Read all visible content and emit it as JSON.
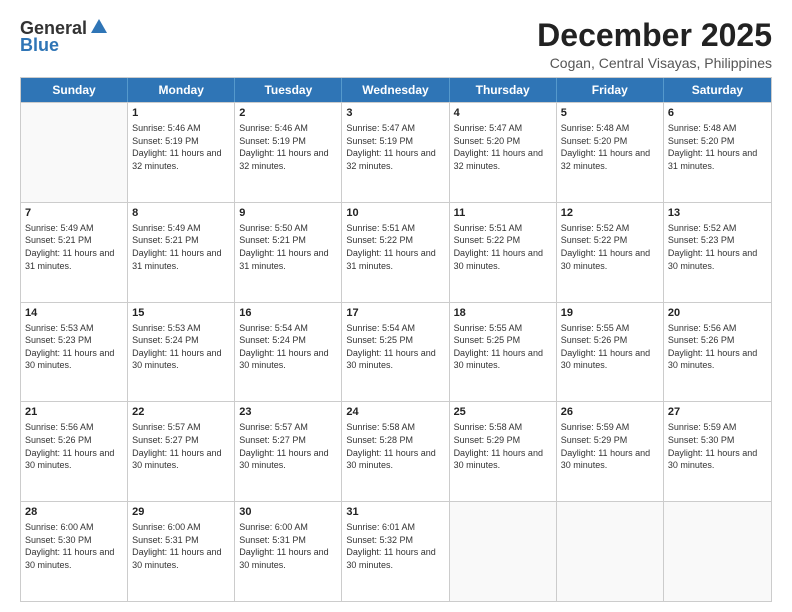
{
  "header": {
    "logo_general": "General",
    "logo_blue": "Blue",
    "month": "December 2025",
    "location": "Cogan, Central Visayas, Philippines"
  },
  "weekdays": [
    "Sunday",
    "Monday",
    "Tuesday",
    "Wednesday",
    "Thursday",
    "Friday",
    "Saturday"
  ],
  "rows": [
    [
      {
        "day": "",
        "empty": true
      },
      {
        "day": "1",
        "sunrise": "5:46 AM",
        "sunset": "5:19 PM",
        "daylight": "11 hours and 32 minutes."
      },
      {
        "day": "2",
        "sunrise": "5:46 AM",
        "sunset": "5:19 PM",
        "daylight": "11 hours and 32 minutes."
      },
      {
        "day": "3",
        "sunrise": "5:47 AM",
        "sunset": "5:19 PM",
        "daylight": "11 hours and 32 minutes."
      },
      {
        "day": "4",
        "sunrise": "5:47 AM",
        "sunset": "5:20 PM",
        "daylight": "11 hours and 32 minutes."
      },
      {
        "day": "5",
        "sunrise": "5:48 AM",
        "sunset": "5:20 PM",
        "daylight": "11 hours and 32 minutes."
      },
      {
        "day": "6",
        "sunrise": "5:48 AM",
        "sunset": "5:20 PM",
        "daylight": "11 hours and 31 minutes."
      }
    ],
    [
      {
        "day": "7",
        "sunrise": "5:49 AM",
        "sunset": "5:21 PM",
        "daylight": "11 hours and 31 minutes."
      },
      {
        "day": "8",
        "sunrise": "5:49 AM",
        "sunset": "5:21 PM",
        "daylight": "11 hours and 31 minutes."
      },
      {
        "day": "9",
        "sunrise": "5:50 AM",
        "sunset": "5:21 PM",
        "daylight": "11 hours and 31 minutes."
      },
      {
        "day": "10",
        "sunrise": "5:51 AM",
        "sunset": "5:22 PM",
        "daylight": "11 hours and 31 minutes."
      },
      {
        "day": "11",
        "sunrise": "5:51 AM",
        "sunset": "5:22 PM",
        "daylight": "11 hours and 30 minutes."
      },
      {
        "day": "12",
        "sunrise": "5:52 AM",
        "sunset": "5:22 PM",
        "daylight": "11 hours and 30 minutes."
      },
      {
        "day": "13",
        "sunrise": "5:52 AM",
        "sunset": "5:23 PM",
        "daylight": "11 hours and 30 minutes."
      }
    ],
    [
      {
        "day": "14",
        "sunrise": "5:53 AM",
        "sunset": "5:23 PM",
        "daylight": "11 hours and 30 minutes."
      },
      {
        "day": "15",
        "sunrise": "5:53 AM",
        "sunset": "5:24 PM",
        "daylight": "11 hours and 30 minutes."
      },
      {
        "day": "16",
        "sunrise": "5:54 AM",
        "sunset": "5:24 PM",
        "daylight": "11 hours and 30 minutes."
      },
      {
        "day": "17",
        "sunrise": "5:54 AM",
        "sunset": "5:25 PM",
        "daylight": "11 hours and 30 minutes."
      },
      {
        "day": "18",
        "sunrise": "5:55 AM",
        "sunset": "5:25 PM",
        "daylight": "11 hours and 30 minutes."
      },
      {
        "day": "19",
        "sunrise": "5:55 AM",
        "sunset": "5:26 PM",
        "daylight": "11 hours and 30 minutes."
      },
      {
        "day": "20",
        "sunrise": "5:56 AM",
        "sunset": "5:26 PM",
        "daylight": "11 hours and 30 minutes."
      }
    ],
    [
      {
        "day": "21",
        "sunrise": "5:56 AM",
        "sunset": "5:26 PM",
        "daylight": "11 hours and 30 minutes."
      },
      {
        "day": "22",
        "sunrise": "5:57 AM",
        "sunset": "5:27 PM",
        "daylight": "11 hours and 30 minutes."
      },
      {
        "day": "23",
        "sunrise": "5:57 AM",
        "sunset": "5:27 PM",
        "daylight": "11 hours and 30 minutes."
      },
      {
        "day": "24",
        "sunrise": "5:58 AM",
        "sunset": "5:28 PM",
        "daylight": "11 hours and 30 minutes."
      },
      {
        "day": "25",
        "sunrise": "5:58 AM",
        "sunset": "5:29 PM",
        "daylight": "11 hours and 30 minutes."
      },
      {
        "day": "26",
        "sunrise": "5:59 AM",
        "sunset": "5:29 PM",
        "daylight": "11 hours and 30 minutes."
      },
      {
        "day": "27",
        "sunrise": "5:59 AM",
        "sunset": "5:30 PM",
        "daylight": "11 hours and 30 minutes."
      }
    ],
    [
      {
        "day": "28",
        "sunrise": "6:00 AM",
        "sunset": "5:30 PM",
        "daylight": "11 hours and 30 minutes."
      },
      {
        "day": "29",
        "sunrise": "6:00 AM",
        "sunset": "5:31 PM",
        "daylight": "11 hours and 30 minutes."
      },
      {
        "day": "30",
        "sunrise": "6:00 AM",
        "sunset": "5:31 PM",
        "daylight": "11 hours and 30 minutes."
      },
      {
        "day": "31",
        "sunrise": "6:01 AM",
        "sunset": "5:32 PM",
        "daylight": "11 hours and 30 minutes."
      },
      {
        "day": "",
        "empty": true
      },
      {
        "day": "",
        "empty": true
      },
      {
        "day": "",
        "empty": true
      }
    ]
  ]
}
